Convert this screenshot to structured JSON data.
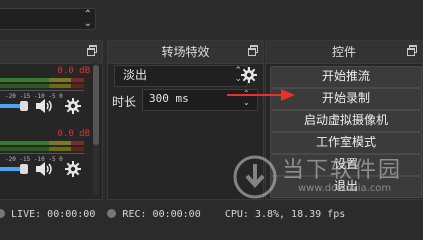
{
  "mixer": {
    "channels": [
      {
        "peak_label": "0.0 dB",
        "scale_labels": "-20   -15   -10   -5   0",
        "volume_level": 0.3
      },
      {
        "peak_label": "0.0 dB",
        "scale_labels": "-20   -15   -10   -5   0",
        "volume_level": 0.3
      }
    ]
  },
  "transitions": {
    "header": "转场特效",
    "selected": "淡出",
    "duration_label": "时长",
    "duration_value": "300 ms"
  },
  "controls": {
    "header": "控件",
    "buttons": [
      "开始推流",
      "开始录制",
      "启动虚拟摄像机",
      "工作室模式",
      "设置",
      "退出"
    ]
  },
  "status": {
    "live_label": "LIVE:",
    "live_time": "00:00:00",
    "rec_label": "REC:",
    "rec_time": "00:00:00",
    "cpu_label": "CPU:",
    "cpu_value": "3.8%, 18.39 fps"
  },
  "watermark": {
    "brand": "当下软件园",
    "url": "www.downxia.com"
  },
  "colors": {
    "annotation_arrow": "#e8312a",
    "meter_peak": "#e03131",
    "volume_slider": "#4aa3f5"
  }
}
